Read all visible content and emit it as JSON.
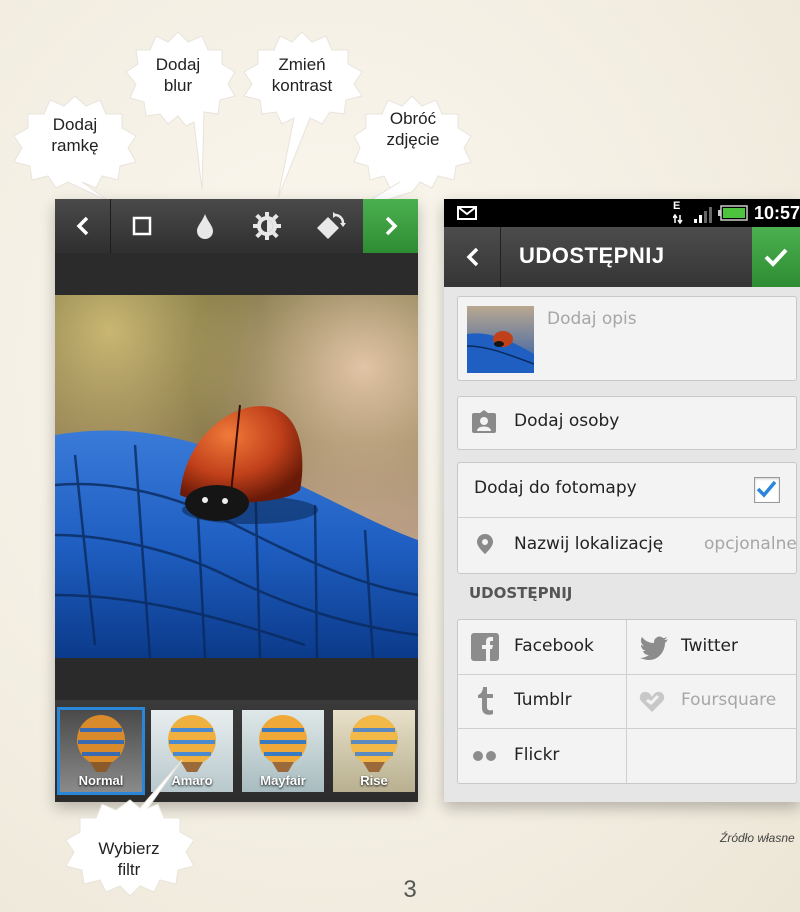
{
  "callouts": {
    "add_frame": "Dodaj ramkę",
    "add_blur": "Dodaj blur",
    "change_contrast": "Zmień kontrast",
    "rotate_photo": "Obróć zdjęcie",
    "choose_filter": "Wybierz filtr"
  },
  "editor": {
    "toolbar_icons": [
      "back-chevron-icon",
      "frame-icon",
      "blur-drop-icon",
      "contrast-icon",
      "rotate-icon",
      "next-chevron-icon"
    ],
    "filters": [
      {
        "label": "Normal",
        "selected": true
      },
      {
        "label": "Amaro",
        "selected": false
      },
      {
        "label": "Mayfair",
        "selected": false
      },
      {
        "label": "Rise",
        "selected": false
      }
    ],
    "accent_color": "#2e8c33",
    "selection_color": "#2a86d8"
  },
  "share_screen": {
    "status_time": "10:57",
    "network_label": "E",
    "title": "UDOSTĘPNIJ",
    "caption_placeholder": "Dodaj opis",
    "tag_people": "Dodaj osoby",
    "add_to_photo_map": "Dodaj do fotomapy",
    "photo_map_checked": true,
    "name_location": "Nazwij lokalizację",
    "optional_hint": "opcjonalne",
    "section_label": "UDOSTĘPNIJ",
    "services": [
      {
        "name": "Facebook",
        "enabled": true
      },
      {
        "name": "Twitter",
        "enabled": true
      },
      {
        "name": "Tumblr",
        "enabled": true
      },
      {
        "name": "Foursquare",
        "enabled": false
      },
      {
        "name": "Flickr",
        "enabled": true
      }
    ]
  },
  "source_note": "Źródło własne",
  "page_number": "3"
}
